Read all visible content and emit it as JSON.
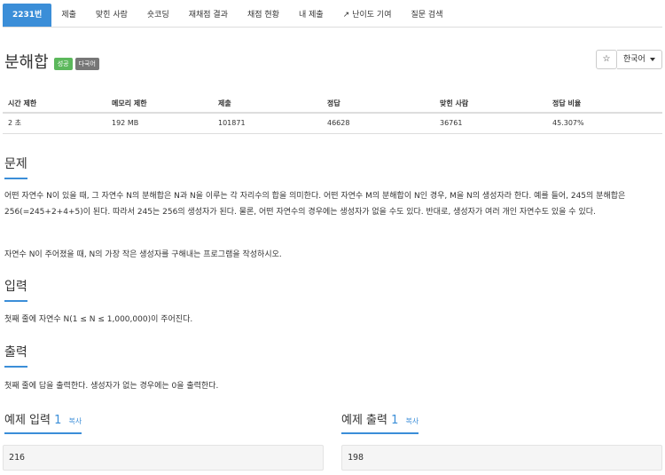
{
  "tabs": [
    {
      "label": "2231번",
      "active": true
    },
    {
      "label": "제출"
    },
    {
      "label": "맞힌 사람"
    },
    {
      "label": "숏코딩"
    },
    {
      "label": "재채점 결과"
    },
    {
      "label": "채점 현황"
    },
    {
      "label": "내 제출"
    },
    {
      "label": "난이도 기여",
      "icon": "external-link-icon"
    },
    {
      "label": "질문 검색"
    }
  ],
  "problem": {
    "title": "분해합",
    "badges": {
      "success": "성공",
      "multi": "다국어"
    }
  },
  "controls": {
    "star": "☆",
    "language": "한국어"
  },
  "stats": {
    "headers": [
      "시간 제한",
      "메모리 제한",
      "제출",
      "정답",
      "맞힌 사람",
      "정답 비율"
    ],
    "values": [
      "2 초",
      "192 MB",
      "101871",
      "46628",
      "36761",
      "45.307%"
    ]
  },
  "sections": {
    "problem_title": "문제",
    "problem_p1": "어떤 자연수 N이 있을 때, 그 자연수 N의 분해합은 N과 N을 이루는 각 자리수의 합을 의미한다. 어떤 자연수 M의 분해합이 N인 경우, M을 N의 생성자라 한다. 예를 들어, 245의 분해합은 256(=245+2+4+5)이 된다. 따라서 245는 256의 생성자가 된다. 물론, 어떤 자연수의 경우에는 생성자가 없을 수도 있다. 반대로, 생성자가 여러 개인 자연수도 있을 수 있다.",
    "problem_p2": "자연수 N이 주어졌을 때, N의 가장 작은 생성자를 구해내는 프로그램을 작성하시오.",
    "input_title": "입력",
    "input_text": "첫째 줄에 자연수 N(1 ≤ N ≤ 1,000,000)이 주어진다.",
    "output_title": "출력",
    "output_text": "첫째 줄에 답을 출력한다. 생성자가 없는 경우에는 0을 출력한다."
  },
  "samples": {
    "input_label": "예제 입력",
    "input_num": "1",
    "output_label": "예제 출력",
    "output_num": "1",
    "copy_label": "복사",
    "input_value": "216",
    "output_value": "198"
  }
}
